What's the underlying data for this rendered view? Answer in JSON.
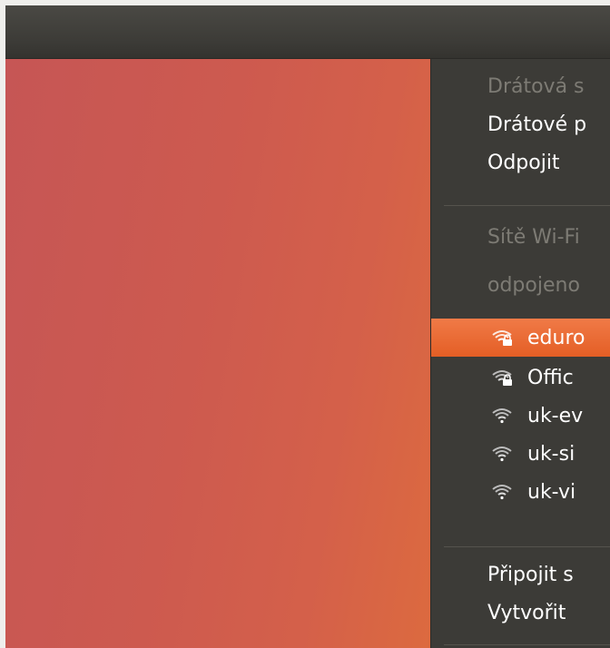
{
  "menu": {
    "wired_header": "Drátová s",
    "wired_network": "Drátové p",
    "disconnect": "Odpojit",
    "wifi_header": "Sítě Wi-Fi",
    "disconnected_status": "odpojeno",
    "networks": [
      {
        "name": "eduro",
        "secured": true,
        "highlighted": true,
        "icon": "wifi-secure-icon"
      },
      {
        "name": "Offic",
        "secured": true,
        "highlighted": false,
        "icon": "wifi-secure-icon"
      },
      {
        "name": "uk-ev",
        "secured": false,
        "highlighted": false,
        "icon": "wifi-icon"
      },
      {
        "name": "uk-si",
        "secured": false,
        "highlighted": false,
        "icon": "wifi-icon"
      },
      {
        "name": "uk-vi",
        "secured": false,
        "highlighted": false,
        "icon": "wifi-icon"
      }
    ],
    "connect_hidden": "Připojit s",
    "create_new": "Vytvořit"
  },
  "colors": {
    "panel": "#3c3b37",
    "highlight": "#e9652d",
    "header_text": "#7d7b74",
    "desktop": "#cd5a4f"
  }
}
